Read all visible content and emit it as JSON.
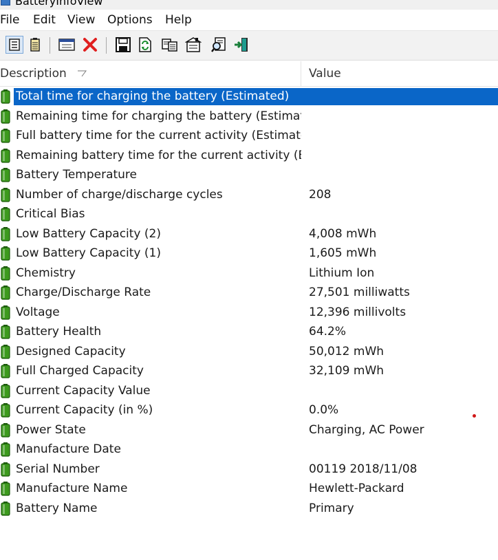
{
  "window": {
    "title": "BatteryInfoView"
  },
  "menu": [
    "File",
    "Edit",
    "View",
    "Options",
    "Help"
  ],
  "toolbar": {
    "buttons": [
      {
        "icon": "battery-info-mode-icon",
        "pressed": true
      },
      {
        "icon": "battery-log-mode-icon",
        "pressed": false
      },
      {
        "icon": "properties-window-icon",
        "pressed": false
      },
      {
        "icon": "delete-icon",
        "pressed": false
      },
      {
        "icon": "save-icon",
        "pressed": false
      },
      {
        "icon": "refresh-icon",
        "pressed": false
      },
      {
        "icon": "copy-icon",
        "pressed": false
      },
      {
        "icon": "properties-icon",
        "pressed": false
      },
      {
        "icon": "find-icon",
        "pressed": false
      },
      {
        "icon": "exit-icon",
        "pressed": false
      }
    ]
  },
  "columns": {
    "description": "Description",
    "value": "Value"
  },
  "rows": [
    {
      "description": "Total  time for charging the battery (Estimated)",
      "value": "",
      "selected": true
    },
    {
      "description": "Remaining time for charging the battery (Estimated)",
      "value": ""
    },
    {
      "description": "Full battery time for the current activity (Estimated)",
      "value": ""
    },
    {
      "description": "Remaining battery time for the current activity (Esti...",
      "value": ""
    },
    {
      "description": "Battery Temperature",
      "value": ""
    },
    {
      "description": "Number of charge/discharge cycles",
      "value": "208"
    },
    {
      "description": "Critical Bias",
      "value": ""
    },
    {
      "description": "Low Battery Capacity (2)",
      "value": "4,008 mWh"
    },
    {
      "description": "Low Battery Capacity (1)",
      "value": "1,605 mWh"
    },
    {
      "description": "Chemistry",
      "value": "Lithium Ion"
    },
    {
      "description": "Charge/Discharge Rate",
      "value": "27,501 milliwatts"
    },
    {
      "description": "Voltage",
      "value": "12,396 millivolts"
    },
    {
      "description": "Battery Health",
      "value": "64.2%"
    },
    {
      "description": "Designed Capacity",
      "value": "50,012 mWh"
    },
    {
      "description": "Full Charged Capacity",
      "value": "32,109 mWh"
    },
    {
      "description": "Current Capacity Value",
      "value": ""
    },
    {
      "description": "Current Capacity (in %)",
      "value": "0.0%"
    },
    {
      "description": "Power State",
      "value": "Charging, AC Power"
    },
    {
      "description": "Manufacture Date",
      "value": ""
    },
    {
      "description": "Serial Number",
      "value": "00119 2018/11/08"
    },
    {
      "description": "Manufacture Name",
      "value": "Hewlett-Packard"
    },
    {
      "description": "Battery Name",
      "value": "Primary"
    }
  ],
  "colors": {
    "selection": "#0a66c8",
    "battery_icon": "#3d9a1e",
    "battery_icon_dark": "#1d5a0c"
  }
}
